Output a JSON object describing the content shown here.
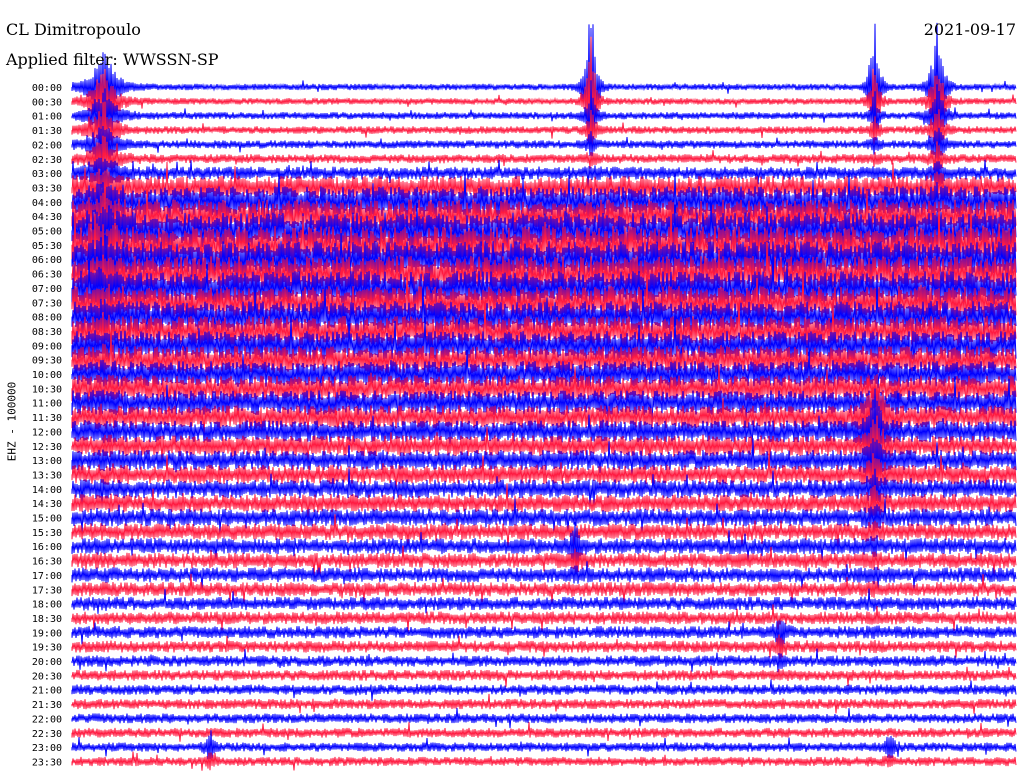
{
  "header": {
    "station": "CL Dimitropoulo",
    "date": "2021-09-17",
    "filter": "Applied filter: WWSSN-SP"
  },
  "chart_data": {
    "type": "helicorder",
    "ylabel": "EHZ - 100000",
    "colors": [
      "#0000ff",
      "#ff1a40"
    ],
    "row_labels": [
      "00:00",
      "00:30",
      "01:00",
      "01:30",
      "02:00",
      "02:30",
      "03:00",
      "03:30",
      "04:00",
      "04:30",
      "05:00",
      "05:30",
      "06:00",
      "06:30",
      "07:00",
      "07:30",
      "08:00",
      "08:30",
      "09:00",
      "09:30",
      "10:00",
      "10:30",
      "11:00",
      "11:30",
      "12:00",
      "12:30",
      "13:00",
      "13:30",
      "14:00",
      "14:30",
      "15:00",
      "15:30",
      "16:00",
      "16:30",
      "17:00",
      "17:30",
      "18:00",
      "18:30",
      "19:00",
      "19:30",
      "20:00",
      "20:30",
      "21:00",
      "21:30",
      "22:00",
      "22:30",
      "23:00",
      "23:30"
    ],
    "row_amplitude": [
      0.25,
      0.25,
      0.28,
      0.3,
      0.32,
      0.36,
      0.5,
      0.9,
      1.2,
      1.3,
      1.4,
      1.45,
      1.4,
      1.35,
      1.3,
      1.25,
      1.2,
      1.15,
      1.1,
      1.05,
      1.0,
      1.0,
      0.95,
      0.9,
      0.85,
      0.8,
      0.78,
      0.75,
      0.72,
      0.7,
      0.68,
      0.65,
      0.62,
      0.6,
      0.58,
      0.56,
      0.52,
      0.5,
      0.48,
      0.46,
      0.44,
      0.42,
      0.4,
      0.4,
      0.38,
      0.38,
      0.36,
      0.36
    ],
    "events": [
      {
        "time": "00:00",
        "minute": 1,
        "amplitude": 3.0,
        "duration_min": 4
      },
      {
        "time": "00:00",
        "minute": 16.5,
        "amplitude": 9.0,
        "duration_min": 0.8
      },
      {
        "time": "00:00",
        "minute": 25.5,
        "amplitude": 6.0,
        "duration_min": 0.8
      },
      {
        "time": "11:30",
        "minute": 25.5,
        "amplitude": 3.5,
        "duration_min": 2
      },
      {
        "time": "00:00",
        "minute": 27.5,
        "amplitude": 5.0,
        "duration_min": 1.5
      },
      {
        "time": "16:00",
        "minute": 16.0,
        "amplitude": 1.6,
        "duration_min": 0.6
      },
      {
        "time": "19:00",
        "minute": 22.5,
        "amplitude": 1.4,
        "duration_min": 0.8
      },
      {
        "time": "23:00",
        "minute": 4.4,
        "amplitude": 1.5,
        "duration_min": 0.5
      },
      {
        "time": "23:00",
        "minute": 26.0,
        "amplitude": 1.3,
        "duration_min": 0.5
      }
    ]
  }
}
